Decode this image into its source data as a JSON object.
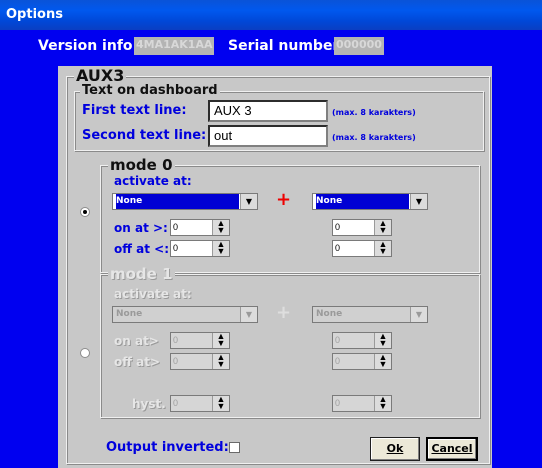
{
  "window": {
    "title": "Options"
  },
  "header": {
    "version_label": "Version info:",
    "version_value": "4MA1AK1AA",
    "serial_label": "Serial number:",
    "serial_value": "000000"
  },
  "aux": {
    "title": "AUX3",
    "text_group": {
      "title": "Text on dashboard",
      "first_label": "First text line:",
      "first_value": "AUX 3",
      "first_hint": "(max. 8 karakters)",
      "second_label": "Second text line:",
      "second_value": "out",
      "second_hint": "(max. 8 karakters)"
    },
    "mode0": {
      "title": "mode 0",
      "activate_label": "activate at:",
      "combo_left": "None",
      "combo_right": "None",
      "plus": "+",
      "on_label": "on at >:",
      "off_label": "off at <:",
      "on_left": "0",
      "on_right": "0",
      "off_left": "0",
      "off_right": "0",
      "selected": true
    },
    "mode1": {
      "title": "mode 1",
      "activate_label": "activate at:",
      "combo_left": "None",
      "combo_right": "None",
      "plus": "+",
      "on_label": "on at>",
      "off_label": "off at>",
      "hyst_label": "hyst.",
      "on_left": "0",
      "on_right": "0",
      "off_left": "0",
      "off_right": "0",
      "hyst_left": "0",
      "hyst_right": "0",
      "selected": false
    },
    "output_inverted_label": "Output inverted:",
    "output_inverted_checked": false
  },
  "buttons": {
    "ok_label": "Ok",
    "cancel_label": "Cancel"
  },
  "colors": {
    "window_bg": "#0000f0",
    "panel_bg": "#c8c8c8",
    "label_blue": "#0000dd",
    "plus_red": "#ee0000"
  }
}
